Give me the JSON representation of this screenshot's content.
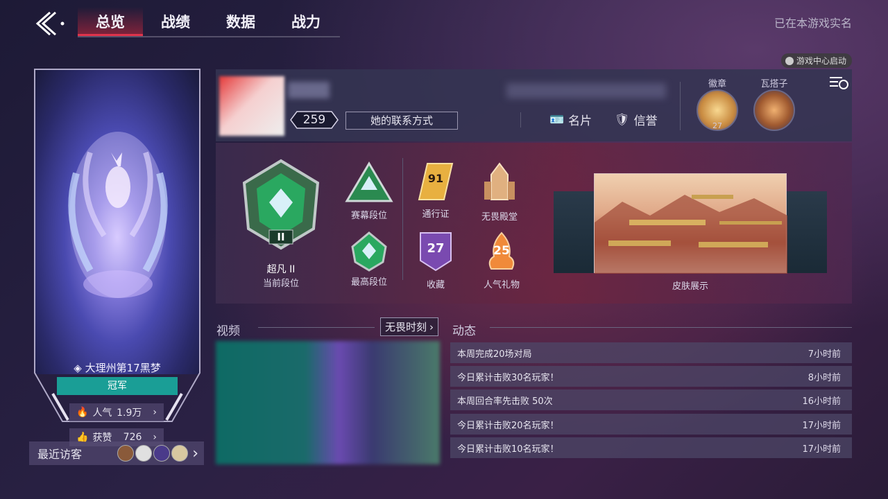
{
  "nav": {
    "tabs": [
      {
        "label": "总览",
        "active": true
      },
      {
        "label": "战绩",
        "active": false
      },
      {
        "label": "数据",
        "active": false
      },
      {
        "label": "战力",
        "active": false
      }
    ],
    "realname_text": "已在本游戏实名",
    "launch_badge": "游戏中心启动"
  },
  "left_card": {
    "region_title": "大理州第17黑梦",
    "champion": "冠军",
    "popularity_label": "人气",
    "popularity_value": "1.9万",
    "likes_label": "获赞",
    "likes_value": "726",
    "recent_visitors_label": "最近访客"
  },
  "profile": {
    "level": "259",
    "contact_btn": "她的联系方式",
    "card_btn": "名片",
    "credit_btn": "信誉",
    "badge_label": "徽章",
    "badge_count": "27",
    "partner_label": "瓦搭子"
  },
  "ranks": {
    "current_rank_name": "超凡 II",
    "current_rank_label": "当前段位",
    "season_rank_label": "赛幕段位",
    "highest_rank_label": "最高段位",
    "pass_value": "91",
    "pass_label": "通行证",
    "hall_label": "无畏殿堂",
    "collection_value": "27",
    "collection_label": "收藏",
    "gift_value": "25",
    "gift_label": "人气礼物",
    "skin_label": "皮肤展示"
  },
  "video": {
    "title": "视频",
    "more_btn": "无畏时刻"
  },
  "activity": {
    "title": "动态",
    "items": [
      {
        "text": "本周完成20场对局",
        "time": "7小时前"
      },
      {
        "text": "今日累计击败30名玩家！",
        "time": "8小时前"
      },
      {
        "text": "本周回合率先击败 50次",
        "time": "16小时前"
      },
      {
        "text": "今日累计击败20名玩家！",
        "time": "17小时前"
      },
      {
        "text": "今日累计击败10名玩家！",
        "time": "17小时前"
      }
    ]
  },
  "colors": {
    "accent_red": "#e0344c",
    "champion_teal": "#1a9e96",
    "panel_bg": "#343452"
  }
}
